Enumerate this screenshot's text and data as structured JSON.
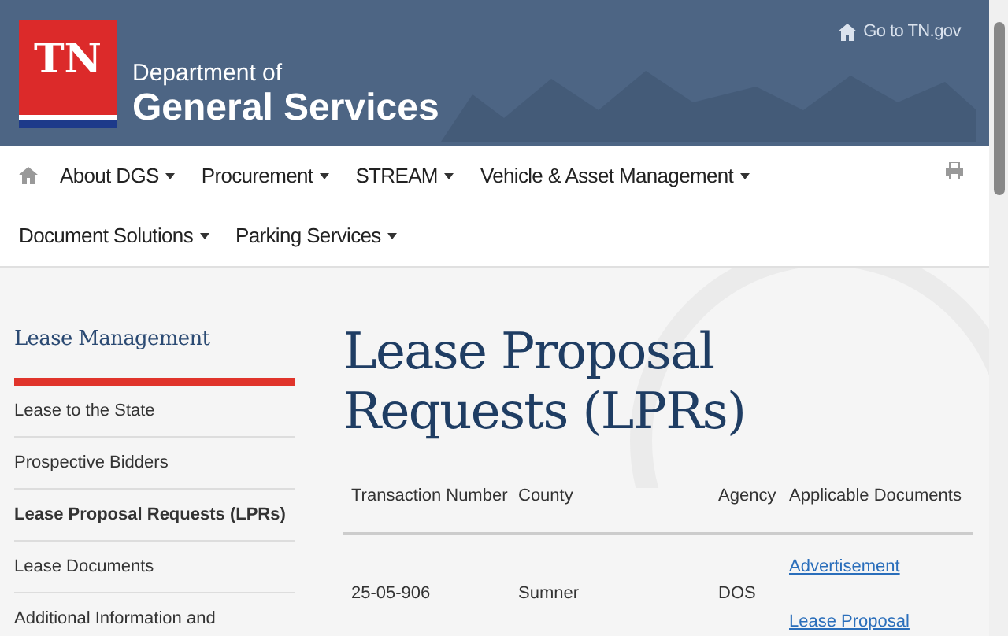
{
  "header": {
    "logo_text": "TN",
    "dept_line1": "Department of",
    "dept_line2": "General Services",
    "top_link": "Go to TN.gov"
  },
  "nav": {
    "items": [
      {
        "label": "About DGS"
      },
      {
        "label": "Procurement"
      },
      {
        "label": "STREAM"
      },
      {
        "label": "Vehicle & Asset Management"
      },
      {
        "label": "Document Solutions"
      },
      {
        "label": "Parking Services"
      }
    ]
  },
  "sidebar": {
    "title": "Lease Management",
    "items": [
      {
        "label": "Lease to the State",
        "selected": false
      },
      {
        "label": "Prospective Bidders",
        "selected": false
      },
      {
        "label": "Lease Proposal Requests (LPRs)",
        "selected": true
      },
      {
        "label": "Lease Documents",
        "selected": false
      },
      {
        "label": "Additional Information and",
        "selected": false
      }
    ]
  },
  "page_title": "Lease Proposal Requests (LPRs)",
  "table": {
    "columns": [
      "Transaction Number",
      "County",
      "Agency",
      "Applicable Documents"
    ],
    "rows": [
      {
        "transaction": "25-05-906",
        "county": "Sumner",
        "agency": "DOS",
        "documents": [
          "Advertisement",
          "Lease Proposal"
        ]
      }
    ]
  }
}
